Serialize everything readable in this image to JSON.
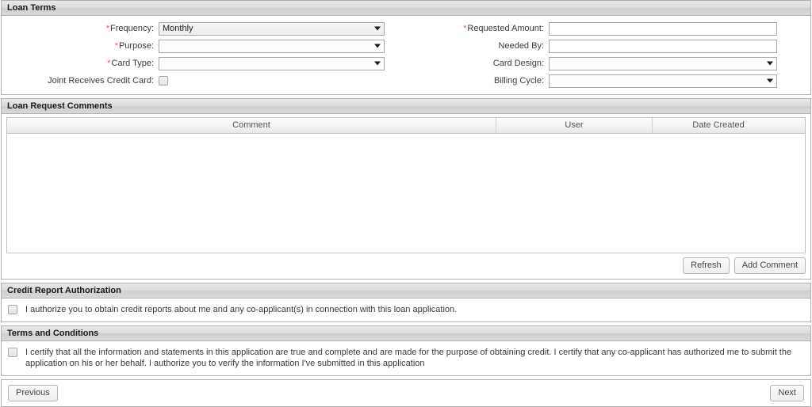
{
  "loan_terms": {
    "title": "Loan Terms",
    "left_fields": [
      {
        "label": "Frequency:",
        "required": true,
        "control": "select",
        "value": "Monthly",
        "name": "frequency"
      },
      {
        "label": "Purpose:",
        "required": true,
        "control": "select",
        "value": "",
        "name": "purpose"
      },
      {
        "label": "Card Type:",
        "required": true,
        "control": "select",
        "value": "",
        "name": "card-type"
      },
      {
        "label": "Joint Receives Credit Card:",
        "required": false,
        "control": "checkbox",
        "checked": false,
        "name": "joint-receives-credit-card"
      }
    ],
    "right_fields": [
      {
        "label": "Requested Amount:",
        "required": true,
        "control": "text",
        "value": "",
        "name": "requested-amount"
      },
      {
        "label": "Needed By:",
        "required": false,
        "control": "text",
        "value": "",
        "name": "needed-by"
      },
      {
        "label": "Card Design:",
        "required": false,
        "control": "select",
        "value": "",
        "name": "card-design"
      },
      {
        "label": "Billing Cycle:",
        "required": false,
        "control": "select",
        "value": "",
        "name": "billing-cycle"
      }
    ]
  },
  "comments": {
    "title": "Loan Request Comments",
    "columns": [
      "Comment",
      "User",
      "Date Created"
    ],
    "rows": [],
    "refresh_label": "Refresh",
    "add_comment_label": "Add Comment"
  },
  "credit_authorization": {
    "title": "Credit Report Authorization",
    "checked": false,
    "text": "I authorize you to obtain credit reports about me and any co-applicant(s) in connection with this loan application."
  },
  "terms_conditions": {
    "title": "Terms and Conditions",
    "checked": false,
    "text": "I certify that all the information and statements in this application are true and complete and are made for the purpose of obtaining credit. I certify that any co-applicant has authorized me to submit the application on his or her behalf. I authorize you to verify the information I've submitted in this application"
  },
  "footer": {
    "previous_label": "Previous",
    "next_label": "Next"
  },
  "colors": {
    "required_marker": "#e05a5a",
    "header_text": "#1a1a1a",
    "border": "#b0b0b0"
  }
}
